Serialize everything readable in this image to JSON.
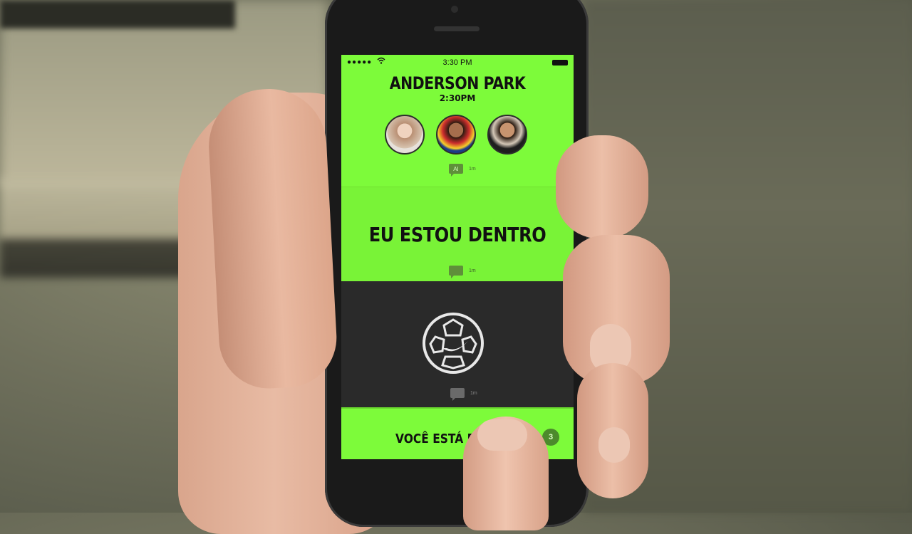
{
  "status_bar": {
    "signal": "●●●●●",
    "wifi": "wifi-icon",
    "time": "3:30 PM",
    "battery": "battery-icon"
  },
  "event": {
    "location": "ANDERSON PARK",
    "time": "2:30PM"
  },
  "participants": [
    {
      "name": "participant-1"
    },
    {
      "name": "participant-2"
    },
    {
      "name": "participant-3"
    }
  ],
  "messages": [
    {
      "badge": "AI",
      "ago": "1m"
    },
    {
      "text": "EU ESTOU DENTRO",
      "ago": "1m"
    },
    {
      "icon": "nike-ball-icon",
      "ago": "1m"
    }
  ],
  "bottom": {
    "label": "VOCÊ ESTÁ D",
    "count": "3"
  },
  "colors": {
    "accent": "#7dfb3a",
    "dark": "#2a2a2a",
    "count_badge": "#4c8a2c"
  }
}
